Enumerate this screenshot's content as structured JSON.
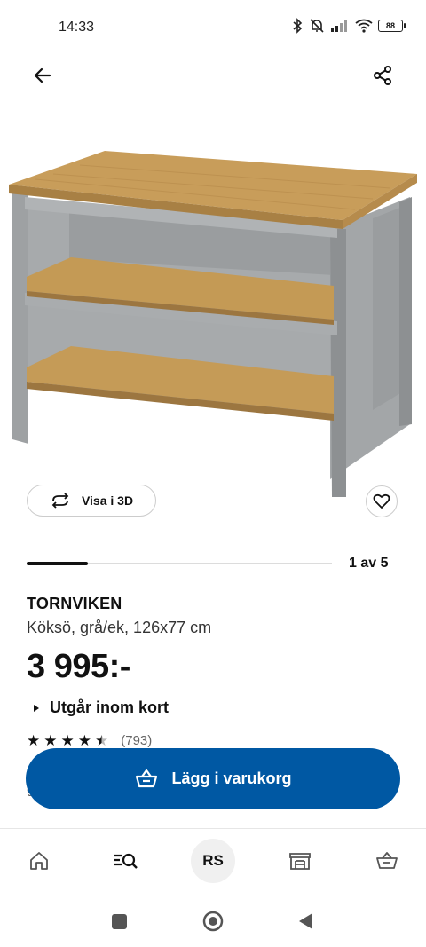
{
  "status_bar": {
    "time": "14:33",
    "battery": "88"
  },
  "product": {
    "name": "TORNVIKEN",
    "description": "Köksö, grå/ek, 126x77 cm",
    "price": "3 995:-",
    "stock_status": "Utgår inom kort",
    "rating": {
      "stars": 4.5,
      "count": "(793)"
    },
    "partial_text": "9",
    "view_3d_label": "Visa i 3D",
    "image_pager": {
      "text": "1 av 5",
      "progress": 0.2
    }
  },
  "cart_button": {
    "label": "Lägg i varukorg"
  },
  "bottom_nav": {
    "items": [
      {
        "name": "home",
        "icon": "home-icon"
      },
      {
        "name": "search",
        "icon": "search-list-icon"
      },
      {
        "name": "profile",
        "label": "RS"
      },
      {
        "name": "stores",
        "icon": "store-icon"
      },
      {
        "name": "cart",
        "icon": "basket-icon"
      }
    ]
  },
  "colors": {
    "accent": "#0058a3",
    "text": "#111111"
  }
}
